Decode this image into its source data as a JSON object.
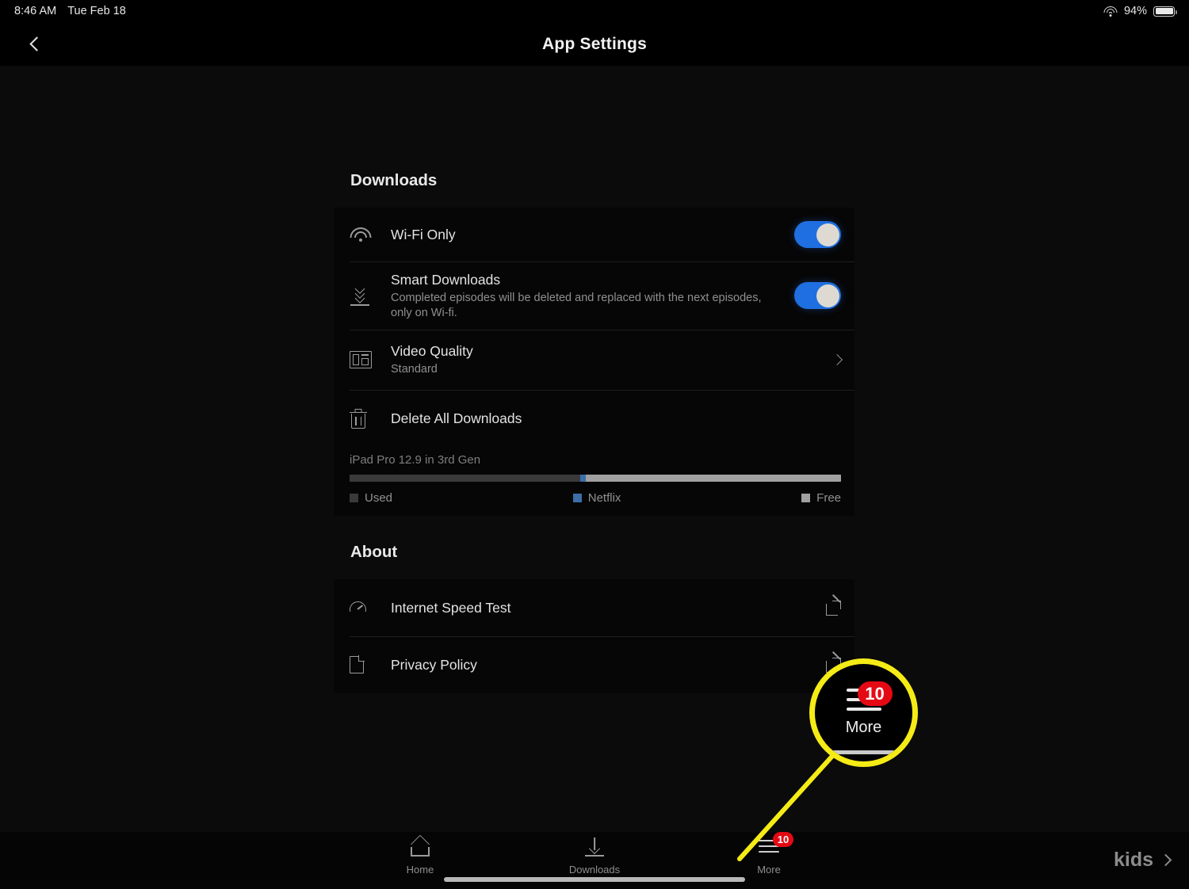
{
  "status_bar": {
    "time": "8:46 AM",
    "date": "Tue Feb 18",
    "battery_percent": "94%",
    "wifi_icon": "wifi-icon",
    "battery_icon": "battery-icon"
  },
  "nav": {
    "title": "App Settings",
    "back_icon": "chevron-left-icon"
  },
  "downloads_section": {
    "heading": "Downloads",
    "rows": [
      {
        "icon": "wifi-icon",
        "title": "Wi-Fi Only",
        "subtitle": "",
        "control": "toggle",
        "toggle_on": true
      },
      {
        "icon": "smart-downloads-icon",
        "title": "Smart Downloads",
        "subtitle": "Completed episodes will be deleted and replaced with the next episodes, only on Wi-fi.",
        "control": "toggle",
        "toggle_on": true
      },
      {
        "icon": "video-quality-icon",
        "title": "Video Quality",
        "subtitle": "Standard",
        "control": "chevron",
        "toggle_on": false
      },
      {
        "icon": "trash-icon",
        "title": "Delete All Downloads",
        "subtitle": "",
        "control": "none",
        "toggle_on": false
      }
    ],
    "storage": {
      "device": "iPad Pro 12.9 in 3rd Gen",
      "used_percent": 47,
      "netflix_percent": 1,
      "free_percent": 52,
      "legend": [
        {
          "label": "Used",
          "color": "#3a3a3a"
        },
        {
          "label": "Netflix",
          "color": "#3c6ea8"
        },
        {
          "label": "Free",
          "color": "#a0a0a0"
        }
      ]
    }
  },
  "about_section": {
    "heading": "About",
    "rows": [
      {
        "icon": "speedometer-icon",
        "title": "Internet Speed Test",
        "tail_icon": "external-link-icon"
      },
      {
        "icon": "document-icon",
        "title": "Privacy Policy",
        "tail_icon": "external-link-icon"
      }
    ]
  },
  "tab_bar": {
    "tabs": [
      {
        "label": "Home",
        "icon": "home-icon",
        "badge": ""
      },
      {
        "label": "Downloads",
        "icon": "download-icon",
        "badge": ""
      },
      {
        "label": "More",
        "icon": "hamburger-icon",
        "badge": "10"
      }
    ],
    "kids_label": "kids",
    "kids_chevron_icon": "chevron-right-icon"
  },
  "callout": {
    "highlight_color": "#f5eb16",
    "badge_count": "10",
    "label": "More",
    "icon": "hamburger-icon"
  }
}
